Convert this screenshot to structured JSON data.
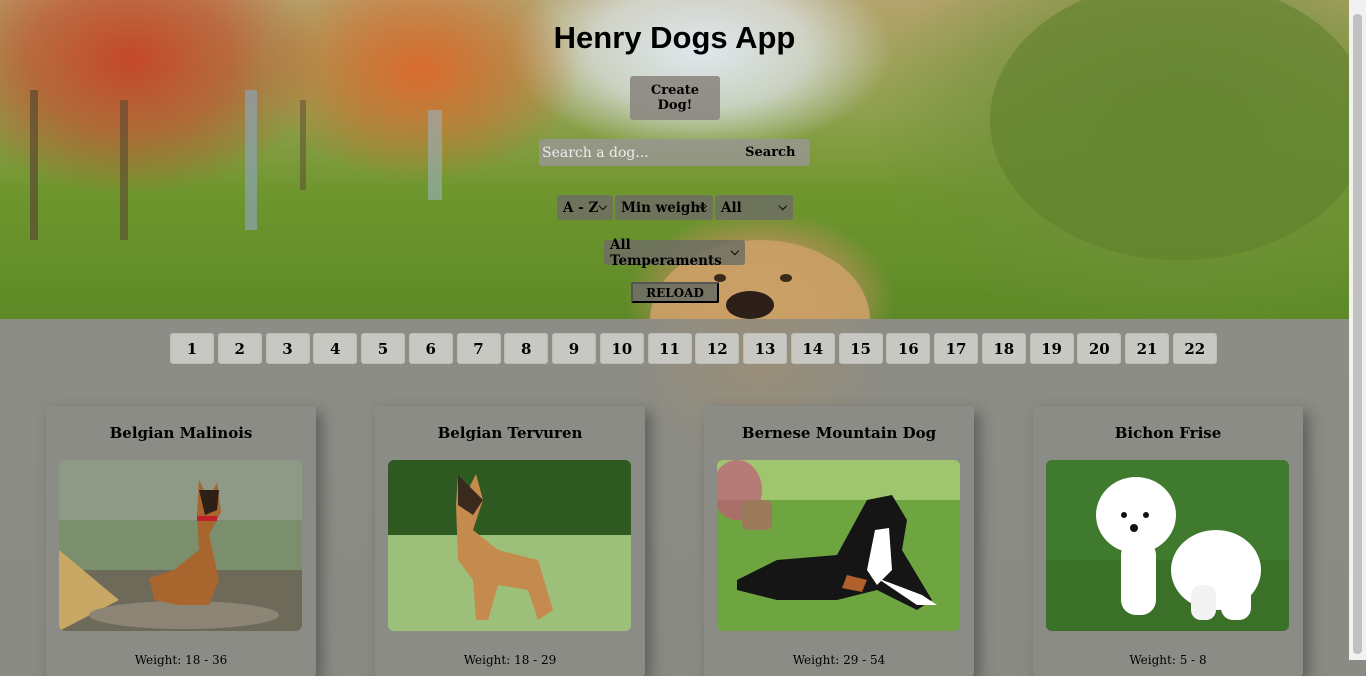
{
  "app": {
    "title": "Henry Dogs App",
    "create_label": "Create Dog!",
    "search_placeholder": "Search a dog...",
    "search_label": "Search",
    "reload_label": "RELOAD"
  },
  "filters": {
    "order": "A - Z",
    "weight": "Min weight",
    "source": "All",
    "temperament": "All Temperaments"
  },
  "pagination": [
    "1",
    "2",
    "3",
    "4",
    "5",
    "6",
    "7",
    "8",
    "9",
    "10",
    "11",
    "12",
    "13",
    "14",
    "15",
    "16",
    "17",
    "18",
    "19",
    "20",
    "21",
    "22"
  ],
  "dogs": [
    {
      "name": "Belgian Malinois",
      "weight": "Weight: 18 - 36"
    },
    {
      "name": "Belgian Tervuren",
      "weight": "Weight: 18 - 29"
    },
    {
      "name": "Bernese Mountain Dog",
      "weight": "Weight: 29 - 54"
    },
    {
      "name": "Bichon Frise",
      "weight": "Weight: 5 - 8"
    }
  ],
  "colors": {
    "panel": "#8a8b84",
    "page_button": "#c8c8c3",
    "card": "#8c8c87"
  }
}
